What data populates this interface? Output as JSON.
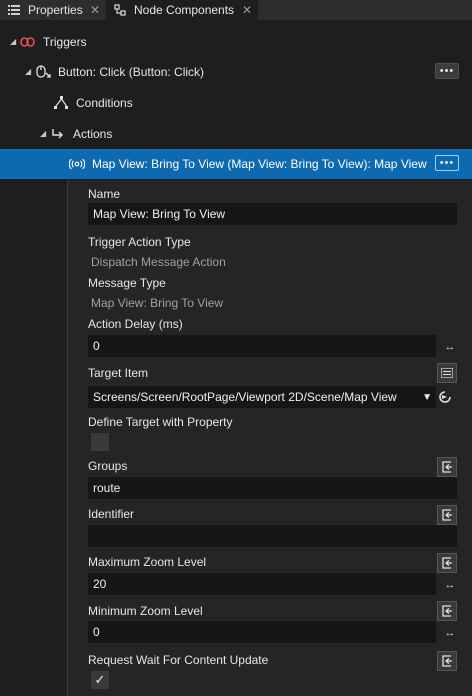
{
  "tabs": [
    {
      "label": "Properties",
      "icon": "list-icon",
      "close": "✕"
    },
    {
      "label": "Node Components",
      "icon": "node-components-icon",
      "close": "✕"
    }
  ],
  "tree": {
    "triggers": "Triggers",
    "button_click": "Button: Click (Button: Click)",
    "conditions": "Conditions",
    "actions": "Actions",
    "selected_action": "Map View: Bring To View (Map View: Bring To View): Map View",
    "more_label": "•••"
  },
  "details": {
    "name_label": "Name",
    "name_value": "Map View: Bring To View",
    "trigger_action_type_label": "Trigger Action Type",
    "trigger_action_type_value": "Dispatch Message Action",
    "message_type_label": "Message Type",
    "message_type_value": "Map View: Bring To View",
    "action_delay_label": "Action Delay (ms)",
    "action_delay_value": "0",
    "target_item_label": "Target Item",
    "target_item_value": "Screens/Screen/RootPage/Viewport 2D/Scene/Map View",
    "define_target_label": "Define Target with Property",
    "groups_label": "Groups",
    "groups_value": "route",
    "identifier_label": "Identifier",
    "identifier_value": "",
    "max_zoom_label": "Maximum Zoom Level",
    "max_zoom_value": "20",
    "min_zoom_label": "Minimum Zoom Level",
    "min_zoom_value": "0",
    "request_wait_label": "Request Wait For Content Update",
    "request_wait_checked": true
  },
  "colors": {
    "selection": "#0e6ab0",
    "trigger_icon": "#e05050",
    "background": "#1e1e1e"
  }
}
